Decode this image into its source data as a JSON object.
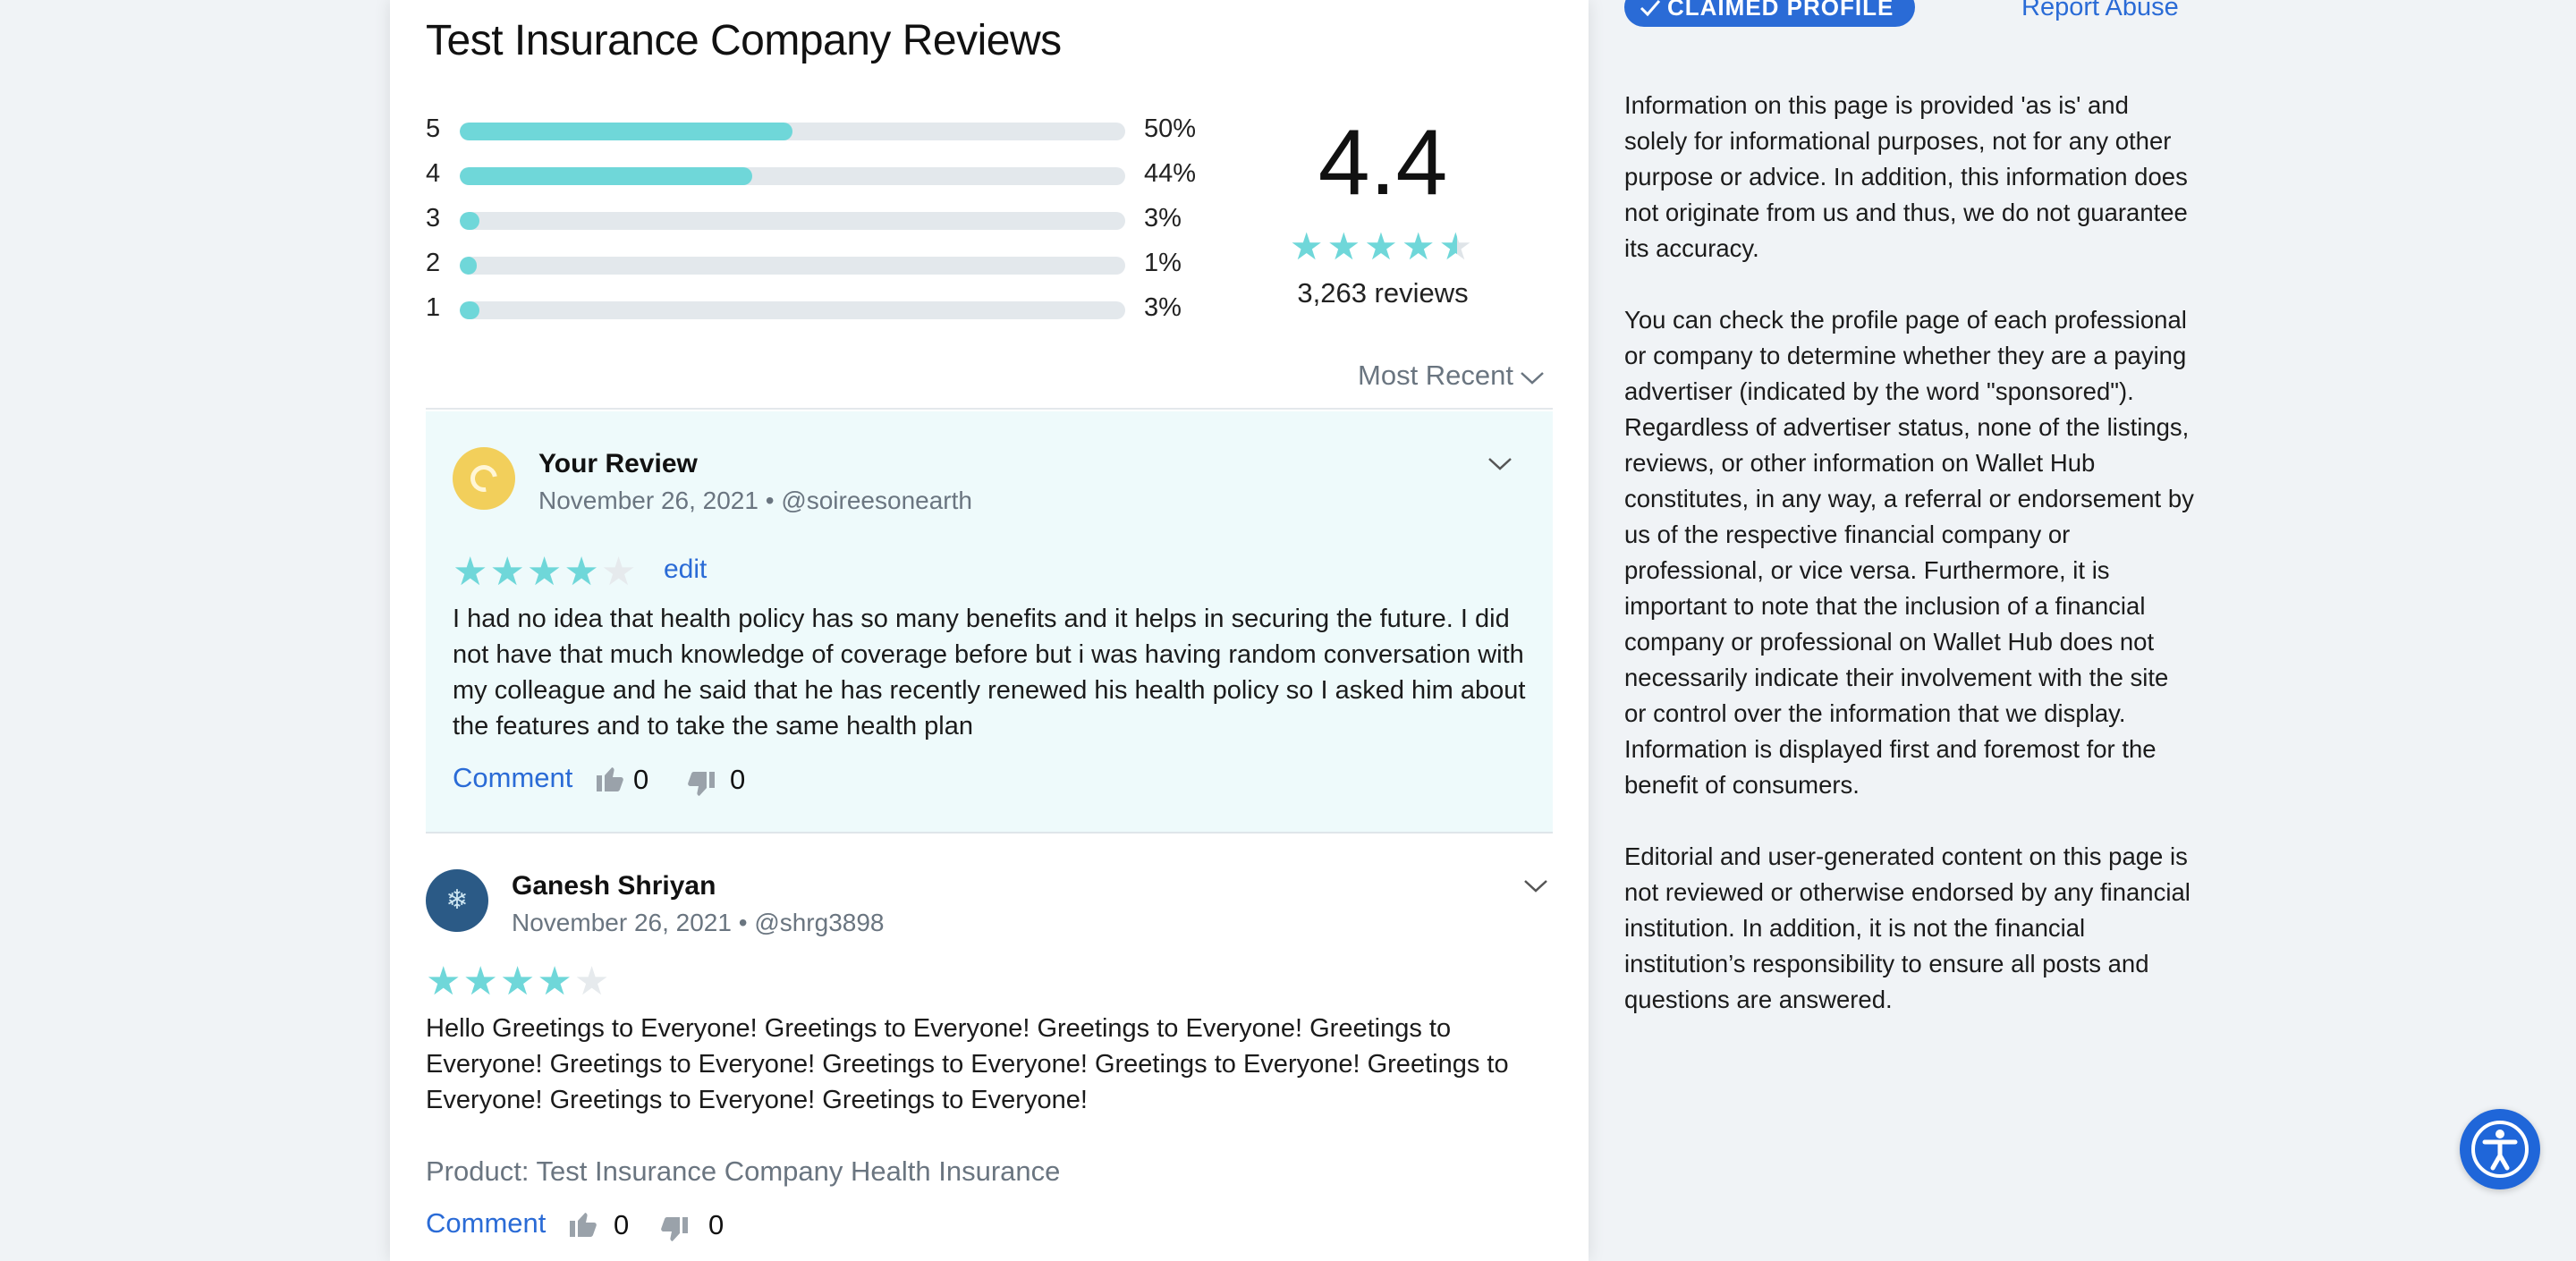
{
  "page_title": "Test Insurance Company Reviews",
  "breakdown": [
    {
      "stars": "5",
      "percent_label": "50%",
      "fill": 0.5
    },
    {
      "stars": "4",
      "percent_label": "44%",
      "fill": 0.44
    },
    {
      "stars": "3",
      "percent_label": "3%",
      "fill": 0.03
    },
    {
      "stars": "2",
      "percent_label": "1%",
      "fill": 0.01
    },
    {
      "stars": "1",
      "percent_label": "3%",
      "fill": 0.03
    }
  ],
  "summary": {
    "average": "4.4",
    "stars": 4.5,
    "total_reviews": "3,263 reviews"
  },
  "sort": {
    "label": "Most Recent"
  },
  "reviews": [
    {
      "name": "Your Review",
      "date": "November 26, 2021",
      "handle": "@soireesonearth",
      "rating": 4,
      "edit_label": "edit",
      "text": "I had no idea that health policy has so many benefits and it helps in securing the future. I did not have that much knowledge of coverage before but i was having random conversation with my colleague and he said that he has recently renewed his health policy so I asked him about the features and to take the same health plan",
      "comment_label": "Comment",
      "likes": "0",
      "dislikes": "0"
    },
    {
      "name": "Ganesh Shriyan",
      "date": "November 26, 2021",
      "handle": "@shrg3898",
      "rating": 4,
      "text": "Hello Greetings to Everyone! Greetings to Everyone! Greetings to Everyone! Greetings to Everyone! Greetings to Everyone! Greetings to Everyone! Greetings to Everyone! Greetings to Everyone! Greetings to Everyone! Greetings to Everyone!",
      "product": "Product: Test Insurance Company Health Insurance",
      "comment_label": "Comment",
      "likes": "0",
      "dislikes": "0"
    }
  ],
  "sidebar": {
    "badge": "CLAIMED PROFILE",
    "report_link": "Report Abuse",
    "paragraphs": [
      "Information on this page is provided 'as is' and solely for informational purposes, not for any other purpose or advice. In addition, this information does not originate from us and thus, we do not guarantee its accuracy.",
      "You can check the profile page of each professional or company to determine whether they are a paying advertiser (indicated by the word \"sponsored\"). Regardless of advertiser status, none of the listings, reviews, or other information on Wallet Hub constitutes, in any way, a referral or endorsement by us of the respective financial company or professional, or vice versa. Furthermore, it is important to note that the inclusion of a financial company or professional on Wallet Hub does not necessarily indicate their involvement with the site or control over the information that we display. Information is displayed first and foremost for the benefit of consumers.",
      "Editorial and user-generated content on this page is not reviewed or otherwise endorsed by any financial institution. In addition, it is not the financial institution’s responsibility to ensure all posts and questions are answered."
    ]
  },
  "colors": {
    "accent": "#2a6bd6",
    "star": "#6fd7d9",
    "own_review_bg": "#eefafb"
  }
}
